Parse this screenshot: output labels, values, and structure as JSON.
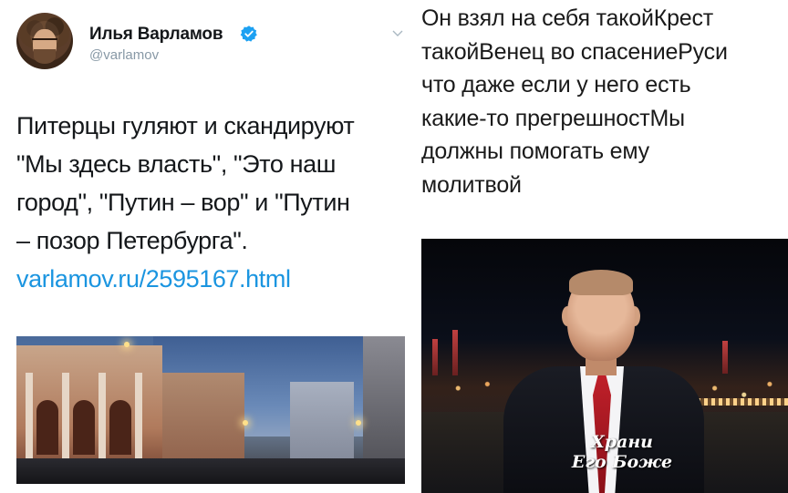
{
  "tweet": {
    "display_name": "Илья Варламов",
    "handle": "@varlamov",
    "text_lines": [
      "Питерцы гуляют и скандируют",
      "\"Мы здесь власть\", \"Это наш",
      "город\", \"Путин – вор\" и \"Путин",
      "– позор Петербурга\"."
    ],
    "link": "varlamov.ru/2595167.html",
    "link_color": "#1b95e0",
    "verified_color": "#1da1f2",
    "icons": [
      "verified-icon",
      "chevron-down-icon"
    ]
  },
  "right_post": {
    "text_lines": [
      "Он взял на себя такойКрест",
      "такойВенец во спасениеРуси",
      "что даже если у него есть",
      "какие-то прегрешностМы",
      "должны помогать ему",
      "молитвой"
    ],
    "image_caption_lines": [
      "Храни",
      "Его Боже"
    ]
  }
}
